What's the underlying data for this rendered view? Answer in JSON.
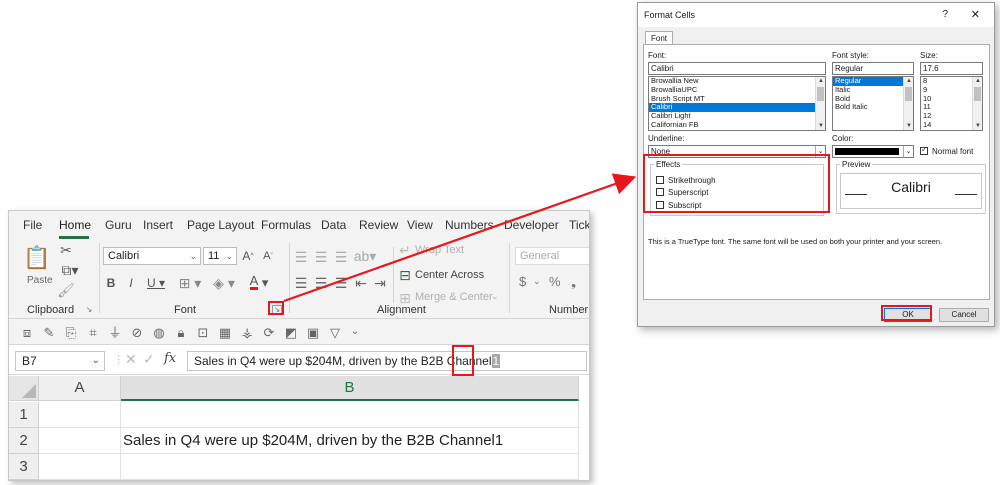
{
  "excel": {
    "tabs": [
      "File",
      "Home",
      "Guru",
      "Insert",
      "Page Layout",
      "Formulas",
      "Data",
      "Review",
      "View",
      "Numbers",
      "Developer",
      "Ticks"
    ],
    "clipboard": {
      "paste_label": "Paste",
      "group_label": "Clipboard"
    },
    "font": {
      "name": "Calibri",
      "size": "11",
      "group_label": "Font"
    },
    "alignment": {
      "wrap_text": "Wrap Text",
      "center_across": "Center Across",
      "merge_center": "Merge & Center",
      "group_label": "Alignment"
    },
    "number": {
      "format": "General",
      "currency": "$",
      "percent": "%",
      "group_label": "Number"
    },
    "formula_bar": {
      "name_box": "B7",
      "fx": "fx",
      "content": "Sales in Q4 were up $204M, driven by the B2B Channel",
      "superscript_char": "1"
    },
    "columns": [
      "A",
      "B"
    ],
    "rows": [
      "1",
      "2",
      "3"
    ],
    "cell_b2": "Sales in Q4 were up $204M, driven by the B2B Channel1"
  },
  "dialog": {
    "title": "Format Cells",
    "help": "?",
    "close": "✕",
    "tab": "Font",
    "font_label": "Font:",
    "font_value": "Calibri",
    "font_list": [
      "Browallia New",
      "BrowalliaUPC",
      "Brush Script MT",
      "Calibri",
      "Calibri Light",
      "Californian FB"
    ],
    "font_selected": "Calibri",
    "style_label": "Font style:",
    "style_value": "Regular",
    "style_list": [
      "Regular",
      "Italic",
      "Bold",
      "Bold Italic"
    ],
    "style_selected": "Regular",
    "size_label": "Size:",
    "size_value": "17.6",
    "size_list": [
      "8",
      "9",
      "10",
      "11",
      "12",
      "14"
    ],
    "underline_label": "Underline:",
    "underline_value": "None",
    "color_label": "Color:",
    "normal_font_label": "Normal font",
    "normal_font_checked": true,
    "effects_label": "Effects",
    "effects": [
      {
        "label": "Strikethrough",
        "checked": false
      },
      {
        "label": "Superscript",
        "checked": false
      },
      {
        "label": "Subscript",
        "checked": false
      }
    ],
    "preview_label": "Preview",
    "preview_text": "Calibri",
    "info_text": "This is a TrueType font.  The same font will be used on both your printer and your screen.",
    "ok_label": "OK",
    "cancel_label": "Cancel"
  },
  "colors": {
    "highlight": "#e8161d",
    "excel_green": "#217346",
    "selection_blue": "#0078d7"
  }
}
